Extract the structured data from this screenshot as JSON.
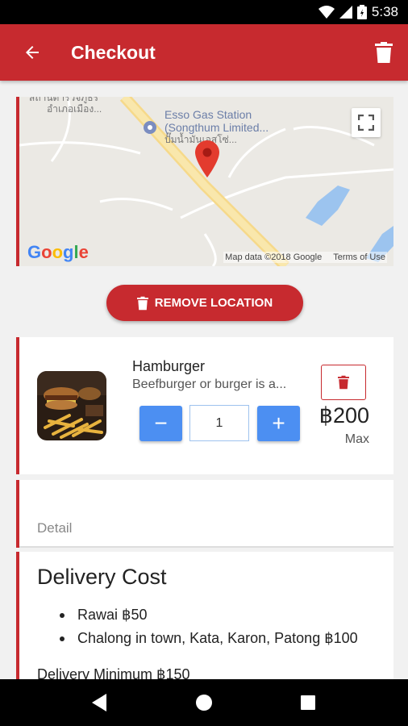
{
  "status_bar": {
    "time": "5:38"
  },
  "app_bar": {
    "title": "Checkout"
  },
  "map": {
    "poi_name": "Esso Gas Station\n(Songthum Limited...",
    "poi_thai": "ปั๊มน้ำมันเอสโซ่...",
    "place_thai_1": "สถานีตำรวจภูธร",
    "place_thai_2": "อำเภอเมือง...",
    "logo": "Google",
    "map_data": "Map data ©2018 Google",
    "terms": "Terms of Use"
  },
  "remove_location_label": "REMOVE LOCATION",
  "product": {
    "name": "Hamburger",
    "description": "Beefburger or burger is a...",
    "quantity": "1",
    "minus_label": "−",
    "plus_label": "+",
    "price": "฿200",
    "max_label": "Max"
  },
  "detail": {
    "label": "Detail"
  },
  "delivery": {
    "title": "Delivery Cost",
    "items": [
      "Rawai ฿50",
      "Chalong in town, Kata, Karon, Patong ฿100"
    ],
    "minimum": "Delivery Minimum ฿150"
  },
  "colors": {
    "primary": "#c72a2f",
    "accent_blue": "#4c8ff2"
  },
  "icons": {
    "back": "arrow-back-icon",
    "trash": "trash-icon",
    "fullscreen": "fullscreen-icon",
    "marker": "map-marker-icon",
    "nav_back": "nav-back-icon",
    "nav_home": "nav-home-icon",
    "nav_recents": "nav-recents-icon"
  }
}
